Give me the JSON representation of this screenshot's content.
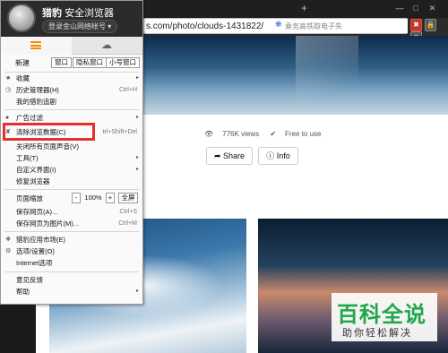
{
  "browser": {
    "new_tab": "+",
    "window_controls": [
      "—",
      "□",
      "✕"
    ],
    "address": "s.com/photo/clouds-1431822/",
    "address_icons": "⚡ ★ ▾",
    "search_placeholder": "乘务高铁取电子失",
    "right_buttons": [
      "✖",
      "🔒",
      "◉"
    ]
  },
  "page": {
    "views": "776K views",
    "license": "Free to use",
    "share_label": "Share",
    "info_label": "Info"
  },
  "watermark": {
    "title": "百科全说",
    "subtitle": "助你轻松解决"
  },
  "menu": {
    "brand_name": "猎豹",
    "brand_suffix": "安全浏览器",
    "login": "登录金山网络帐号 ▾",
    "quick_new": "新建",
    "quick_buttons": [
      "窗口",
      "隐私窗口",
      "小号窗口"
    ],
    "items": [
      {
        "icon": "★",
        "label": "收藏",
        "shortcut": "",
        "arrow": "▸"
      },
      {
        "icon": "◷",
        "label": "历史管理器(H)",
        "shortcut": "Ctrl+H",
        "arrow": ""
      },
      {
        "icon": "",
        "label": "我的猎豹追剧",
        "shortcut": "",
        "arrow": ""
      },
      {
        "icon": "●",
        "label": "广告过滤",
        "shortcut": "",
        "arrow": "▸"
      },
      {
        "icon": "✘",
        "label": "清除浏览数据(C)",
        "shortcut": "trl+Shift+Del",
        "arrow": ""
      },
      {
        "icon": "",
        "label": "关闭所有页面声音(V)",
        "shortcut": "",
        "arrow": ""
      },
      {
        "icon": "",
        "label": "工具(T)",
        "shortcut": "",
        "arrow": "▸"
      },
      {
        "icon": "",
        "label": "自定义界面(I)",
        "shortcut": "",
        "arrow": "▸"
      },
      {
        "icon": "",
        "label": "修复浏览器",
        "shortcut": "",
        "arrow": ""
      },
      {
        "icon": "",
        "label": "保存网页(A)...",
        "shortcut": "Ctrl+S",
        "arrow": ""
      },
      {
        "icon": "",
        "label": "保存网页为图片(M)...",
        "shortcut": "Ctrl+M",
        "arrow": ""
      },
      {
        "icon": "❖",
        "label": "猎豹应用市场(E)",
        "shortcut": "",
        "arrow": ""
      },
      {
        "icon": "⚙",
        "label": "选项/设置(O)",
        "shortcut": "",
        "arrow": ""
      },
      {
        "icon": "",
        "label": "Internet选项",
        "shortcut": "",
        "arrow": ""
      },
      {
        "icon": "",
        "label": "意见反馈",
        "shortcut": "",
        "arrow": ""
      },
      {
        "icon": "",
        "label": "帮助",
        "shortcut": "",
        "arrow": "▸"
      }
    ],
    "zoom": {
      "label": "页面缩放",
      "minus": "-",
      "value": "100%",
      "plus": "+",
      "fullscreen": "全屏"
    }
  },
  "colors": {
    "accent": "#ff8a00",
    "highlight": "#e53030",
    "watermark_green": "#1fa84a"
  }
}
